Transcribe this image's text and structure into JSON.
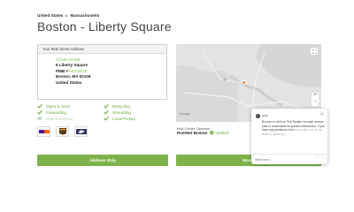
{
  "breadcrumb": {
    "country": "United States",
    "state": "Massachusetts"
  },
  "page_title": "Boston - Liberty Square",
  "address_card": {
    "header": "Your Real Street Address",
    "name": "YOUR NAME",
    "line1": "6 Liberty Square",
    "pmb_prefix": "PMB #",
    "mailbox": "MAILBOX",
    "city_line": "Boston, MA 02109",
    "country": "United States"
  },
  "features": [
    {
      "label": "Open & Scan",
      "included": true
    },
    {
      "label": "Forwarding",
      "included": true
    },
    {
      "label": "Check Deposit",
      "included": false
    },
    {
      "label": "Recycling",
      "included": true
    },
    {
      "label": "Shredding",
      "included": true
    },
    {
      "label": "Local Pickup",
      "included": true
    }
  ],
  "carriers": [
    "fedex-icon",
    "ups-icon",
    "usps-icon"
  ],
  "map": {
    "google_label": "Google"
  },
  "mail_center": {
    "label": "Mail Center Operator",
    "name": "PostNet Boston",
    "verified": "Verified"
  },
  "buttons": {
    "left": "Address Only",
    "right": "Bosto"
  },
  "chat": {
    "agent": "gabi",
    "message": "Be sure to click on 'Full Details' for each service plan to understand its specific instructions. If you have any questions, feel",
    "message_faded": "free to ask one of our team to assist you...",
    "input_placeholder": "Write here..."
  },
  "colors": {
    "accent_green": "#7db34a",
    "check_green": "#6aa73a",
    "map_pin": "#e8862c"
  }
}
